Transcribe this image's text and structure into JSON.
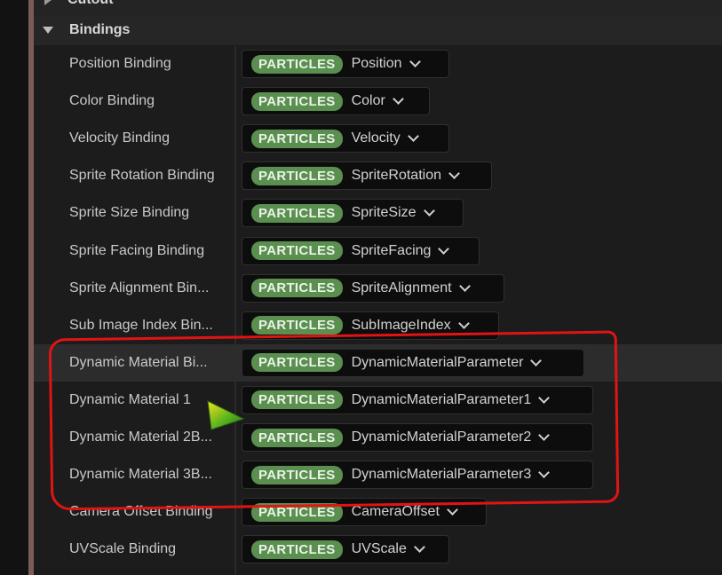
{
  "sections": {
    "cutout": "Cutout",
    "bindings": "Bindings"
  },
  "rows": [
    {
      "name": "Position Binding",
      "badge": "PARTICLES",
      "value": "Position",
      "w": 234
    },
    {
      "name": "Color Binding",
      "badge": "PARTICLES",
      "value": "Color",
      "w": 212
    },
    {
      "name": "Velocity Binding",
      "badge": "PARTICLES",
      "value": "Velocity",
      "w": 234
    },
    {
      "name": "Sprite Rotation Binding",
      "badge": "PARTICLES",
      "value": "SpriteRotation",
      "w": 282
    },
    {
      "name": "Sprite Size Binding",
      "badge": "PARTICLES",
      "value": "SpriteSize",
      "w": 250
    },
    {
      "name": "Sprite Facing Binding",
      "badge": "PARTICLES",
      "value": "SpriteFacing",
      "w": 268
    },
    {
      "name": "Sprite Alignment Bin...",
      "badge": "PARTICLES",
      "value": "SpriteAlignment",
      "w": 296
    },
    {
      "name": "Sub Image Index Bin...",
      "badge": "PARTICLES",
      "value": "SubImageIndex",
      "w": 290
    },
    {
      "name": "Dynamic Material Bi...",
      "badge": "PARTICLES",
      "value": "DynamicMaterialParameter",
      "w": 386
    },
    {
      "name": "Dynamic Material 1",
      "badge": "PARTICLES",
      "value": "DynamicMaterialParameter1",
      "w": 396
    },
    {
      "name": "Dynamic Material 2B...",
      "badge": "PARTICLES",
      "value": "DynamicMaterialParameter2",
      "w": 396
    },
    {
      "name": "Dynamic Material 3B...",
      "badge": "PARTICLES",
      "value": "DynamicMaterialParameter3",
      "w": 396
    },
    {
      "name": "Camera Offset Binding",
      "badge": "PARTICLES",
      "value": "CameraOffset",
      "w": 276
    },
    {
      "name": "UVScale Binding",
      "badge": "PARTICLES",
      "value": "UVScale",
      "w": 234
    }
  ],
  "highlighted_row": 8,
  "colors": {
    "badge": "#5a8f50",
    "annotation": "#e11414",
    "panel": "#1c1c1c"
  }
}
